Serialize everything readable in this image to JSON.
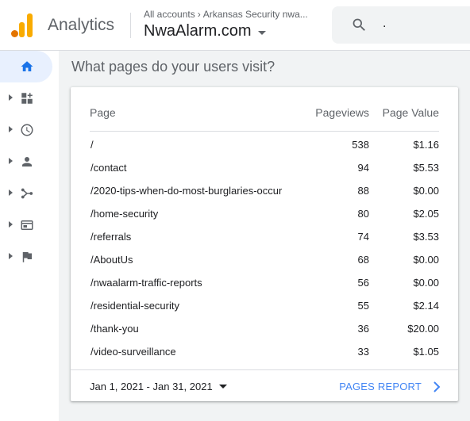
{
  "header": {
    "app_name": "Analytics",
    "breadcrumb": {
      "account": "All accounts",
      "property_path": "Arkansas Security nwa..."
    },
    "property_name": "NwaAlarm.com",
    "search": {
      "value": "."
    }
  },
  "sidebar": {
    "items": [
      {
        "icon": "home-icon",
        "active": true
      },
      {
        "icon": "customization-icon"
      },
      {
        "icon": "realtime-icon"
      },
      {
        "icon": "audience-icon"
      },
      {
        "icon": "acquisition-icon"
      },
      {
        "icon": "behavior-icon"
      },
      {
        "icon": "conversions-icon"
      }
    ]
  },
  "main": {
    "title": "What pages do your users visit?",
    "table": {
      "columns": [
        "Page",
        "Pageviews",
        "Page Value"
      ],
      "rows": [
        {
          "page": "/",
          "pageviews": "538",
          "value": "$1.16"
        },
        {
          "page": "/contact",
          "pageviews": "94",
          "value": "$5.53"
        },
        {
          "page": "/2020-tips-when-do-most-burglaries-occur",
          "pageviews": "88",
          "value": "$0.00"
        },
        {
          "page": "/home-security",
          "pageviews": "80",
          "value": "$2.05"
        },
        {
          "page": "/referrals",
          "pageviews": "74",
          "value": "$3.53"
        },
        {
          "page": "/AboutUs",
          "pageviews": "68",
          "value": "$0.00"
        },
        {
          "page": "/nwaalarm-traffic-reports",
          "pageviews": "56",
          "value": "$0.00"
        },
        {
          "page": "/residential-security",
          "pageviews": "55",
          "value": "$2.14"
        },
        {
          "page": "/thank-you",
          "pageviews": "36",
          "value": "$20.00"
        },
        {
          "page": "/video-surveillance",
          "pageviews": "33",
          "value": "$1.05"
        }
      ]
    },
    "footer": {
      "date_range": "Jan 1, 2021 - Jan 31, 2021",
      "report_link": "PAGES REPORT"
    }
  },
  "colors": {
    "accent": "#1a73e8",
    "link": "#4285f4",
    "logo_orange": "#f9ab00",
    "logo_dark": "#e37400"
  }
}
